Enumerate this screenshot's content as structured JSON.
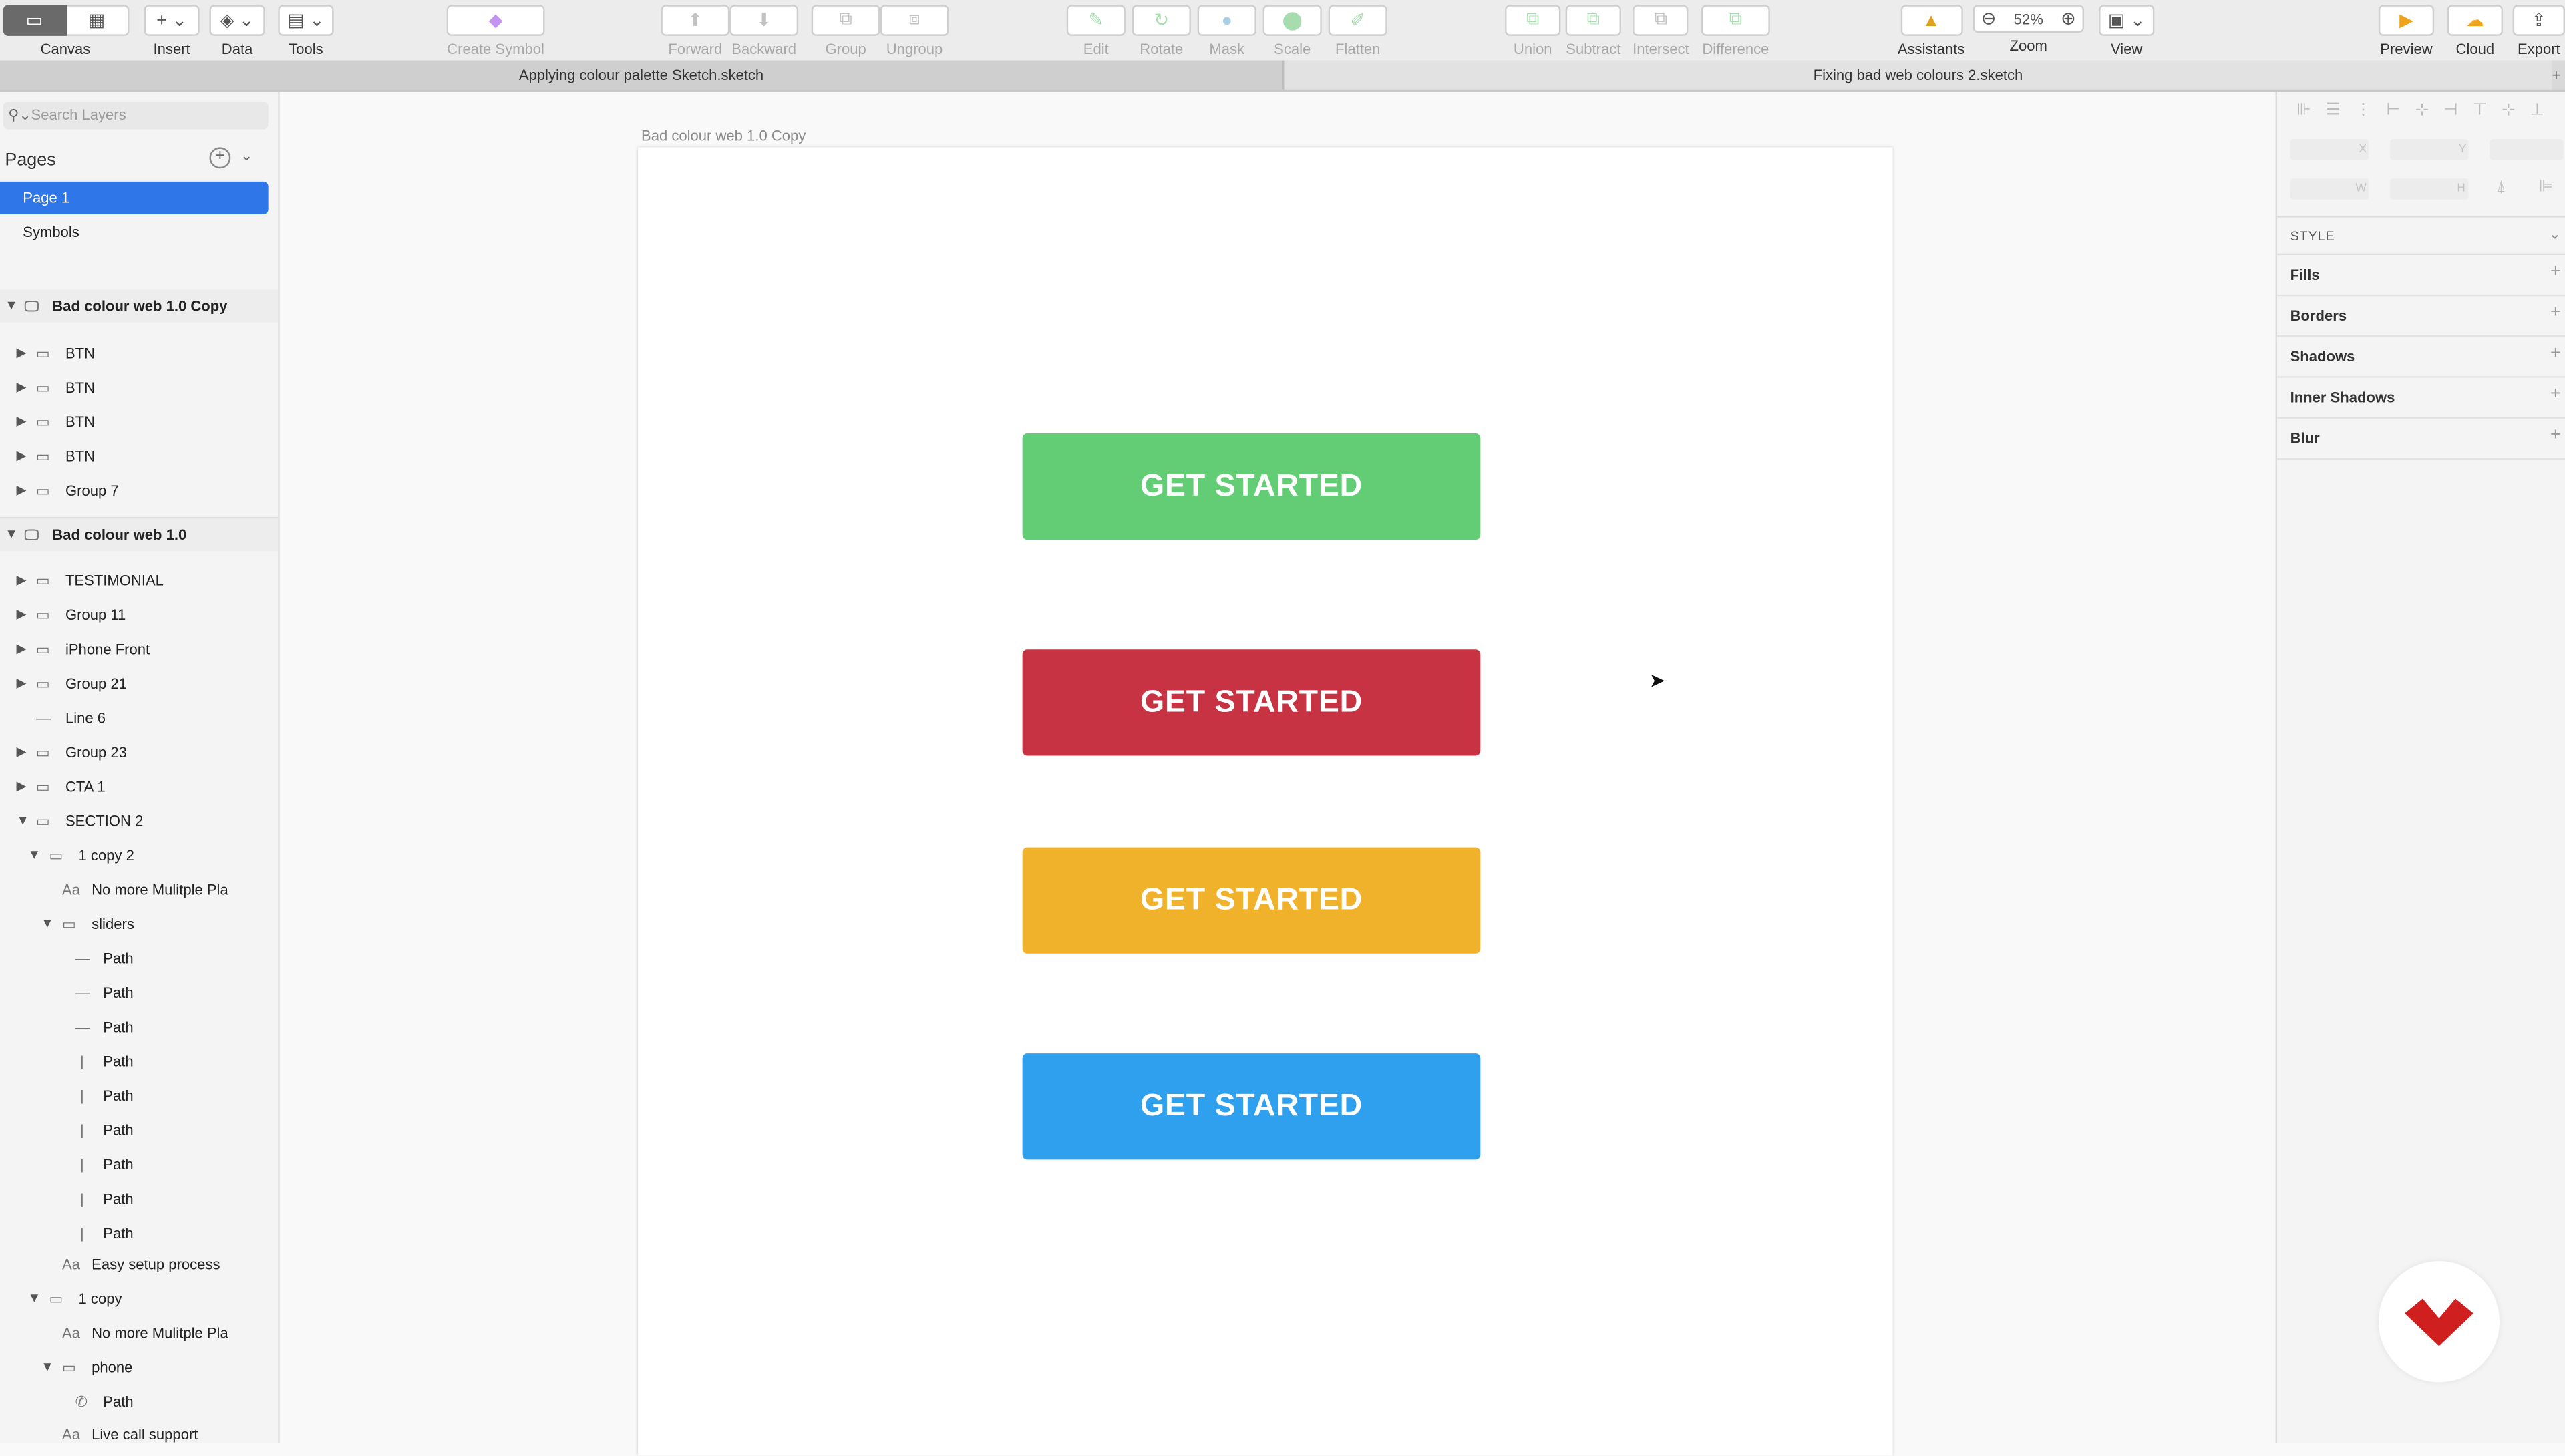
{
  "toolbar": {
    "canvas": "Canvas",
    "insert": "Insert",
    "data": "Data",
    "tools": "Tools",
    "create_symbol": "Create Symbol",
    "forward": "Forward",
    "backward": "Backward",
    "group": "Group",
    "ungroup": "Ungroup",
    "edit": "Edit",
    "rotate": "Rotate",
    "mask": "Mask",
    "scale": "Scale",
    "flatten": "Flatten",
    "union": "Union",
    "subtract": "Subtract",
    "intersect": "Intersect",
    "difference": "Difference",
    "assistants": "Assistants",
    "zoom_label": "Zoom",
    "zoom_value": "52%",
    "view": "View",
    "preview": "Preview",
    "cloud": "Cloud",
    "export": "Export"
  },
  "tabs": {
    "tab1": "Applying colour palette Sketch.sketch",
    "tab2": "Fixing bad web colours 2.sketch"
  },
  "left": {
    "search_placeholder": "Search Layers",
    "pages_heading": "Pages",
    "pages": [
      "Page 1",
      "Symbols"
    ],
    "artboard1": {
      "name": "Bad colour web 1.0 Copy",
      "layers": [
        "BTN",
        "BTN",
        "BTN",
        "BTN",
        "Group 7"
      ]
    },
    "artboard2": {
      "name": "Bad colour web 1.0",
      "layers": [
        "TESTIMONIAL",
        "Group 11",
        "iPhone Front",
        "Group 21",
        "Line 6",
        "Group 23",
        "CTA 1",
        "SECTION 2",
        "1 copy 2",
        "No more Mulitple Pla",
        "sliders",
        "Path",
        "Path",
        "Path",
        "Path",
        "Path",
        "Path",
        "Path",
        "Path",
        "Path",
        "Easy setup process",
        "1 copy",
        "No more Mulitple Pla",
        "phone",
        "Path",
        "Live call support"
      ]
    }
  },
  "canvas": {
    "artboard_title": "Bad colour web 1.0 Copy",
    "buttons": [
      {
        "label": "GET STARTED",
        "color": "#62cd74"
      },
      {
        "label": "GET STARTED",
        "color": "#c83343"
      },
      {
        "label": "GET STARTED",
        "color": "#f0b12b"
      },
      {
        "label": "GET STARTED",
        "color": "#2ea0ee"
      }
    ]
  },
  "inspector": {
    "style_heading": "STYLE",
    "x_label": "X",
    "y_label": "Y",
    "w_label": "W",
    "h_label": "H",
    "fills": "Fills",
    "borders": "Borders",
    "shadows": "Shadows",
    "inner_shadows": "Inner Shadows",
    "blur": "Blur"
  },
  "colors": {
    "selection": "#2f77e8",
    "brand_logo": "#d01f1f"
  }
}
